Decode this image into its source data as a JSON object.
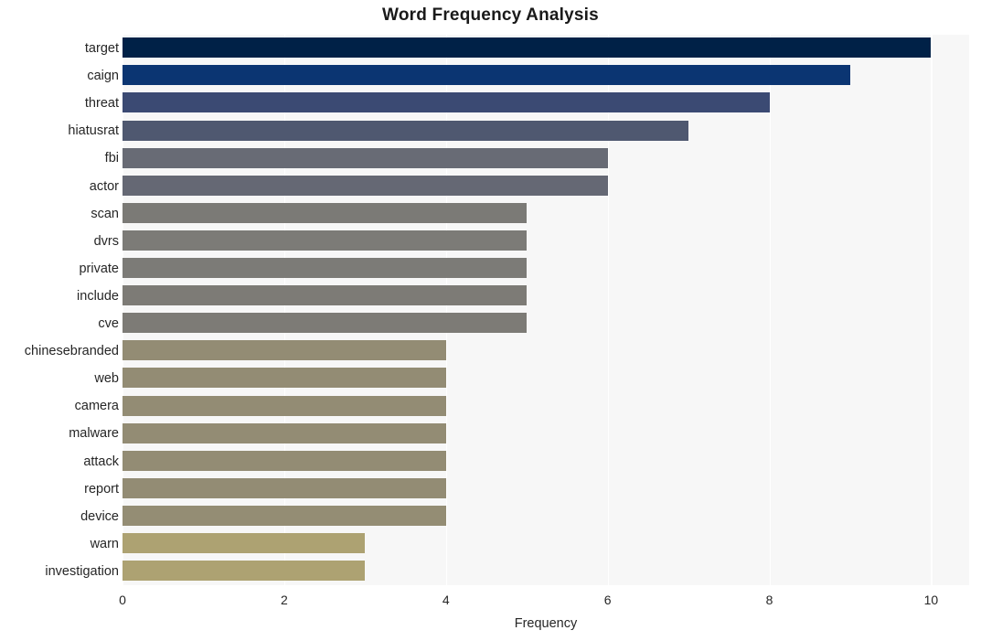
{
  "chart_data": {
    "type": "bar",
    "orientation": "horizontal",
    "title": "Word Frequency Analysis",
    "xlabel": "Frequency",
    "ylabel": "",
    "xlim": [
      0,
      10.47
    ],
    "ylim": [
      0,
      20
    ],
    "grid": true,
    "legend": null,
    "xticks": [
      "0",
      "2",
      "4",
      "6",
      "8",
      "10"
    ],
    "xtick_values": [
      0,
      2,
      4,
      6,
      8,
      10
    ],
    "categories": [
      "target",
      "caign",
      "threat",
      "hiatusrat",
      "fbi",
      "actor",
      "scan",
      "dvrs",
      "private",
      "include",
      "cve",
      "chinesebranded",
      "web",
      "camera",
      "malware",
      "attack",
      "report",
      "device",
      "warn",
      "investigation"
    ],
    "values": [
      10,
      9,
      8,
      7,
      6,
      6,
      5,
      5,
      5,
      5,
      5,
      4,
      4,
      4,
      4,
      4,
      4,
      4,
      3,
      3
    ],
    "bar_colors": [
      "#002147",
      "#0b3572",
      "#3b4a73",
      "#4f5870",
      "#686b75",
      "#656874",
      "#7b7a76",
      "#7c7b77",
      "#7c7b77",
      "#7d7b76",
      "#7d7b76",
      "#938c74",
      "#938c74",
      "#938c74",
      "#938c74",
      "#938c74",
      "#938c74",
      "#948d74",
      "#ada272",
      "#ada272"
    ],
    "plot_background": "#f7f7f7",
    "gridline_color": "#ffffff",
    "text_color": "#262626",
    "figure_background": "#ffffff"
  }
}
